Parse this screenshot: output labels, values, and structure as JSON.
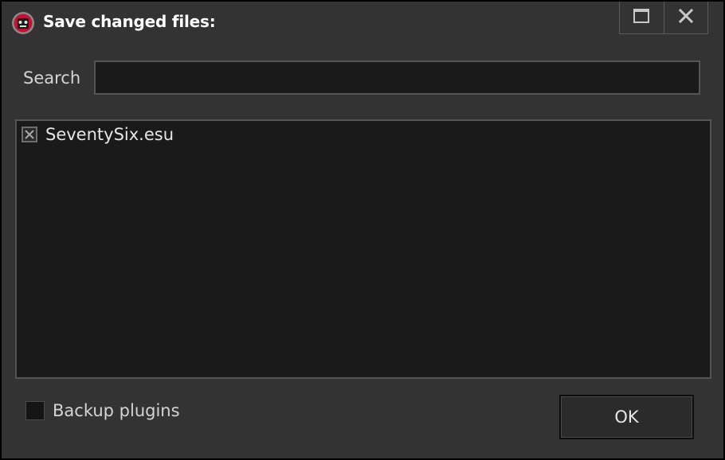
{
  "window": {
    "title": "Save changed files:",
    "app_icon": "app-logo-icon",
    "caption_buttons": {
      "maximize_icon": "maximize-icon",
      "close_icon": "close-icon"
    }
  },
  "search": {
    "label": "Search",
    "value": "",
    "placeholder": ""
  },
  "file_list": {
    "items": [
      {
        "name": "SeventySix.esu",
        "checked": true
      }
    ]
  },
  "backup": {
    "label": "Backup plugins",
    "checked": false
  },
  "ok_button": {
    "label": "OK"
  },
  "colors": {
    "window_bg": "#333333",
    "field_bg": "#1a1a1a",
    "border": "#555555",
    "text": "#d4d4d4",
    "icon_red": "#c8102e"
  }
}
